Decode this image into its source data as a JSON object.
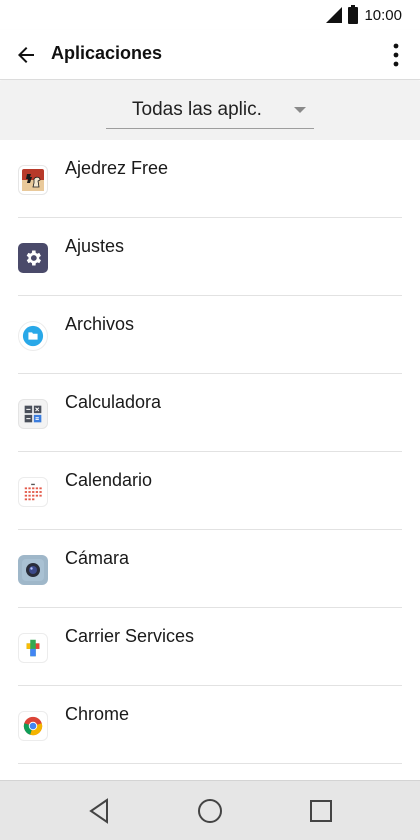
{
  "status_bar": {
    "time": "10:00"
  },
  "app_bar": {
    "title": "Aplicaciones"
  },
  "filter": {
    "selected": "Todas las aplic."
  },
  "apps": [
    {
      "name": "Ajedrez Free",
      "icon": "chess-app-icon"
    },
    {
      "name": "Ajustes",
      "icon": "settings-app-icon"
    },
    {
      "name": "Archivos",
      "icon": "files-app-icon"
    },
    {
      "name": "Calculadora",
      "icon": "calculator-app-icon"
    },
    {
      "name": "Calendario",
      "icon": "calendar-app-icon"
    },
    {
      "name": "Cámara",
      "icon": "camera-app-icon"
    },
    {
      "name": "Carrier Services",
      "icon": "carrier-services-app-icon"
    },
    {
      "name": "Chrome",
      "icon": "chrome-app-icon"
    }
  ],
  "colors": {
    "settings_icon": "#4a4a6a",
    "files_icon": "#29a8e8",
    "nav_bar": "#e6e6e6"
  }
}
